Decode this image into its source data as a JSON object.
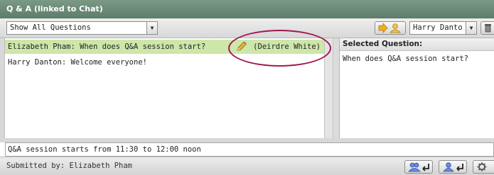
{
  "window": {
    "title": "Q & A (linked to Chat)"
  },
  "toolbar": {
    "view_select": "Show All Questions",
    "assign_select": "Harry Danto",
    "send_icon": "send-to-user-icon",
    "delete_icon": "trash-icon"
  },
  "questions": [
    {
      "text": "Elizabeth Pham: When does Q&A session start?",
      "owner": "(Deirdre White)",
      "selected": true,
      "edit_icon": "pencil-icon"
    },
    {
      "text": "Harry  Danton: Welcome everyone!",
      "owner": "",
      "selected": false
    }
  ],
  "detail": {
    "header": "Selected Question:",
    "question": "When does Q&A session start?"
  },
  "answer": {
    "value": "Q&A session starts from 11:30 to 12:00 noon"
  },
  "status": {
    "submitted": "Submitted by: Elizabeth Pham",
    "buttons": [
      "send-to-all-icon",
      "send-to-user-icon",
      "settings-icon"
    ]
  },
  "colors": {
    "title_bar": "#6b8b78",
    "selected_row": "#cde6a9",
    "highlight_circle": "#a3194e"
  }
}
